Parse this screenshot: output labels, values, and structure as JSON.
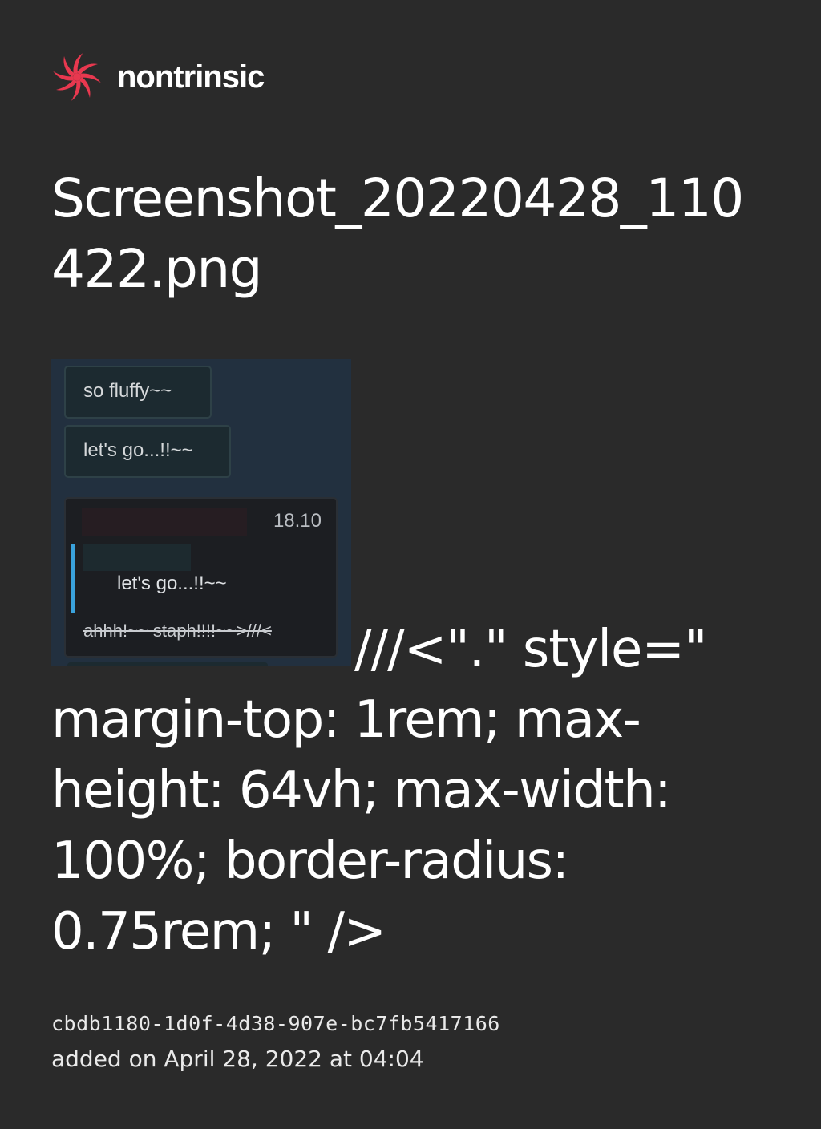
{
  "brand": {
    "name": "nontrinsic",
    "logo_icon": "spiral-logo-icon",
    "logo_color": "#e8384f"
  },
  "file": {
    "title": "Screenshot_20220428_110422.png",
    "id": "cbdb1180-1d0f-4d38-907e-bc7fb5417166",
    "added_on": "added on April 28, 2022 at 04:04"
  },
  "thumbnail": {
    "bubbles": [
      "so fluffy~~",
      "let's go...!!~~"
    ],
    "reply_time": "18.10",
    "reply_quote": "let's go...!!~~",
    "reply_struck": "ahhh!~~ staph!!!!~~>///<",
    "quote_bar_color": "#3aa2dc"
  },
  "leaked_markup": {
    "first_line": "///<\".\" style=\"",
    "lines": [
      "margin-top: 1rem; max-",
      "height: 64vh; max-width:",
      "100%; border-radius:",
      "0.75rem; \" />"
    ]
  }
}
